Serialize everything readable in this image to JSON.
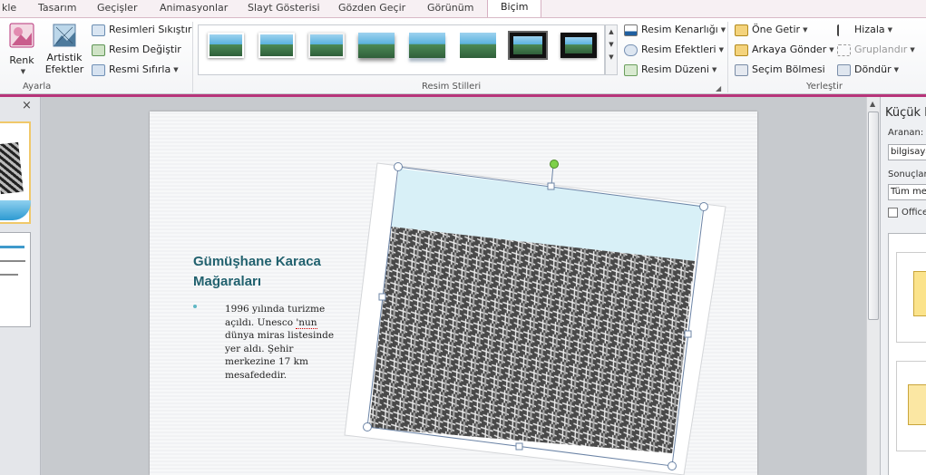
{
  "tabs": [
    "kle",
    "Tasarım",
    "Geçişler",
    "Animasyonlar",
    "Slayt Gösterisi",
    "Gözden Geçir",
    "Görünüm",
    "Biçim"
  ],
  "ayarla": {
    "color_label": "Renk",
    "artistic_label_1": "Artistik",
    "artistic_label_2": "Efektler",
    "compress": "Resimleri Sıkıştır",
    "change": "Resim Değiştir",
    "reset": "Resmi Sıfırla",
    "group_label": "Ayarla"
  },
  "styles": {
    "group_label": "Resim Stilleri",
    "border": "Resim Kenarlığı",
    "effects": "Resim Efektleri",
    "layout": "Resim Düzeni"
  },
  "arrange": {
    "bring_forward": "Öne Getir",
    "send_backward": "Arkaya Gönder",
    "selection_pane": "Seçim Bölmesi",
    "align": "Hizala",
    "group": "Gruplandır",
    "rotate": "Döndür",
    "group_label": "Yerleştir"
  },
  "slide": {
    "title": "Gümüşhane Karaca Mağaraları",
    "body_part1": "1996 yılında turizme açıldı. Unesco ",
    "body_misspelled": "'nun",
    "body_part2": " dünya miras listesinde yer aldı. Şehir merkezine 17 km mesafededir."
  },
  "clipart_pane": {
    "title": "Küçük R",
    "search_label": "Aranan:",
    "search_value": "bilgisaya",
    "results_label": "Sonuçlar",
    "results_value": "Tüm med",
    "office_check": "Office"
  },
  "left_panel": {
    "close_icon": "×"
  },
  "colors": {
    "ribbon_accent": "#b7347a",
    "title_color": "#21616e",
    "bullet_color": "#5fb7c4"
  }
}
